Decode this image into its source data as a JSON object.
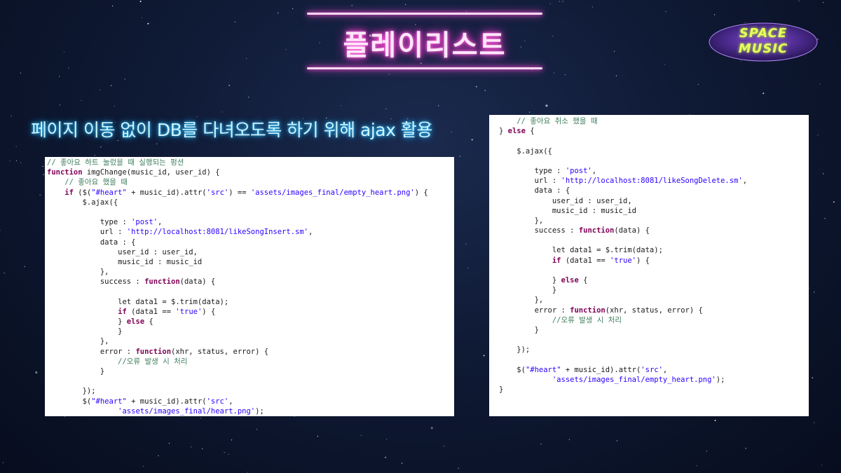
{
  "title": "플레이리스트",
  "logo": {
    "line1": "SPACE",
    "line2": "MUSIC"
  },
  "subtitle": "페이지 이동 없이 DB를 다녀오도록 하기 위해 ajax 활용",
  "code_left": [
    [
      [
        "cm",
        "// 좋아요 하트 눌렀을 때 실행되는 펑션"
      ]
    ],
    [
      [
        "kw",
        "function"
      ],
      [
        "n",
        " imgChange(music_id, user_id) {"
      ]
    ],
    [
      [
        "n",
        "    "
      ],
      [
        "cm",
        "// 좋아요 했을 때"
      ]
    ],
    [
      [
        "n",
        "    "
      ],
      [
        "kw",
        "if"
      ],
      [
        "n",
        " ($("
      ],
      [
        "st",
        "\"#heart\""
      ],
      [
        "n",
        " + music_id).attr("
      ],
      [
        "st",
        "'src'"
      ],
      [
        "n",
        ") == "
      ],
      [
        "st",
        "'assets/images_final/empty_heart.png'"
      ],
      [
        "n",
        ") {"
      ]
    ],
    [
      [
        "n",
        "        $.ajax({"
      ]
    ],
    [
      [
        "n",
        ""
      ]
    ],
    [
      [
        "n",
        "            type : "
      ],
      [
        "st",
        "'post'"
      ],
      [
        "n",
        ","
      ]
    ],
    [
      [
        "n",
        "            url : "
      ],
      [
        "st",
        "'http://localhost:8081/likeSongInsert.sm'"
      ],
      [
        "n",
        ","
      ]
    ],
    [
      [
        "n",
        "            data : {"
      ]
    ],
    [
      [
        "n",
        "                user_id : user_id,"
      ]
    ],
    [
      [
        "n",
        "                music_id : music_id"
      ]
    ],
    [
      [
        "n",
        "            },"
      ]
    ],
    [
      [
        "n",
        "            success : "
      ],
      [
        "kw",
        "function"
      ],
      [
        "n",
        "(data) {"
      ]
    ],
    [
      [
        "n",
        ""
      ]
    ],
    [
      [
        "n",
        "                let data1 = $.trim(data);"
      ]
    ],
    [
      [
        "n",
        "                "
      ],
      [
        "kw",
        "if"
      ],
      [
        "n",
        " (data1 == "
      ],
      [
        "st",
        "'true'"
      ],
      [
        "n",
        ") {"
      ]
    ],
    [
      [
        "n",
        "                } "
      ],
      [
        "kw",
        "else"
      ],
      [
        "n",
        " {"
      ]
    ],
    [
      [
        "n",
        "                }"
      ]
    ],
    [
      [
        "n",
        "            },"
      ]
    ],
    [
      [
        "n",
        "            error : "
      ],
      [
        "kw",
        "function"
      ],
      [
        "n",
        "(xhr, status, error) {"
      ]
    ],
    [
      [
        "n",
        "                "
      ],
      [
        "cm",
        "//오류 발생 시 처리"
      ]
    ],
    [
      [
        "n",
        "            }"
      ]
    ],
    [
      [
        "n",
        ""
      ]
    ],
    [
      [
        "n",
        "        });"
      ]
    ],
    [
      [
        "n",
        "        $("
      ],
      [
        "st",
        "\"#heart\""
      ],
      [
        "n",
        " + music_id).attr("
      ],
      [
        "st",
        "'src'"
      ],
      [
        "n",
        ","
      ]
    ],
    [
      [
        "n",
        "                "
      ],
      [
        "st",
        "'assets/images_final/heart.png'"
      ],
      [
        "n",
        ");"
      ]
    ]
  ],
  "code_right": [
    [
      [
        "n",
        "    "
      ],
      [
        "cm",
        "// 좋아요 취소 했을 때"
      ]
    ],
    [
      [
        "n",
        "} "
      ],
      [
        "kw",
        "else"
      ],
      [
        "n",
        " {"
      ]
    ],
    [
      [
        "n",
        ""
      ]
    ],
    [
      [
        "n",
        "    $.ajax({"
      ]
    ],
    [
      [
        "n",
        ""
      ]
    ],
    [
      [
        "n",
        "        type : "
      ],
      [
        "st",
        "'post'"
      ],
      [
        "n",
        ","
      ]
    ],
    [
      [
        "n",
        "        url : "
      ],
      [
        "st",
        "'http://localhost:8081/likeSongDelete.sm'"
      ],
      [
        "n",
        ","
      ]
    ],
    [
      [
        "n",
        "        data : {"
      ]
    ],
    [
      [
        "n",
        "            user_id : user_id,"
      ]
    ],
    [
      [
        "n",
        "            music_id : music_id"
      ]
    ],
    [
      [
        "n",
        "        },"
      ]
    ],
    [
      [
        "n",
        "        success : "
      ],
      [
        "kw",
        "function"
      ],
      [
        "n",
        "(data) {"
      ]
    ],
    [
      [
        "n",
        ""
      ]
    ],
    [
      [
        "n",
        "            let data1 = $.trim(data);"
      ]
    ],
    [
      [
        "n",
        "            "
      ],
      [
        "kw",
        "if"
      ],
      [
        "n",
        " (data1 == "
      ],
      [
        "st",
        "'true'"
      ],
      [
        "n",
        ") {"
      ]
    ],
    [
      [
        "n",
        ""
      ]
    ],
    [
      [
        "n",
        "            } "
      ],
      [
        "kw",
        "else"
      ],
      [
        "n",
        " {"
      ]
    ],
    [
      [
        "n",
        "            }"
      ]
    ],
    [
      [
        "n",
        "        },"
      ]
    ],
    [
      [
        "n",
        "        error : "
      ],
      [
        "kw",
        "function"
      ],
      [
        "n",
        "(xhr, status, error) {"
      ]
    ],
    [
      [
        "n",
        "            "
      ],
      [
        "cm",
        "//오류 발생 시 처리"
      ]
    ],
    [
      [
        "n",
        "        }"
      ]
    ],
    [
      [
        "n",
        ""
      ]
    ],
    [
      [
        "n",
        "    });"
      ]
    ],
    [
      [
        "n",
        ""
      ]
    ],
    [
      [
        "n",
        "    $("
      ],
      [
        "st",
        "\"#heart\""
      ],
      [
        "n",
        " + music_id).attr("
      ],
      [
        "st",
        "'src'"
      ],
      [
        "n",
        ","
      ]
    ],
    [
      [
        "n",
        "            "
      ],
      [
        "st",
        "'assets/images_final/empty_heart.png'"
      ],
      [
        "n",
        ");"
      ]
    ],
    [
      [
        "n",
        "}"
      ]
    ]
  ]
}
